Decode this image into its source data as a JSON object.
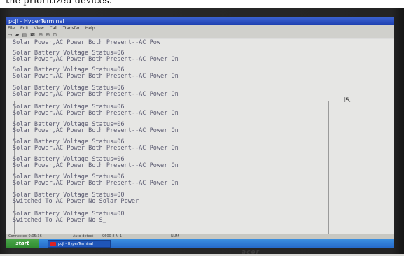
{
  "caption": "the prioritized devices.",
  "window": {
    "title": "pcjl - HyperTerminal",
    "menu": [
      "File",
      "Edit",
      "View",
      "Call",
      "Transfer",
      "Help"
    ],
    "toolbar_glyphs": "▭ ▰ ▤ ☎ ⊟ ⊞ ⊡"
  },
  "terminal": {
    "lines": [
      "Solar Power,AC Power Both Present--AC Pow",
      "Solar Battery Voltage Status=06",
      "Solar Power,AC Power Both Present--AC Power On",
      "Solar Battery Voltage Status=06",
      "Solar Power,AC Power Both Present--AC Power On",
      "Solar Battery Voltage Status=06",
      "Solar Power,AC Power Both Present--AC Power On",
      "Solar Battery Voltage Status=06",
      "Solar Power,AC Power Both Present--AC Power On",
      "Solar Battery Voltage Status=06",
      "Solar Power,AC Power Both Present--AC Power On",
      "Solar Battery Voltage Status=06",
      "Solar Power,AC Power Both Present--AC Power On",
      "Solar Battery Voltage Status=06",
      "Solar Power,AC Power Both Present--AC Power On",
      "Solar Battery Voltage Status=06",
      "Solar Power,AC Power Both Present--AC Power On",
      "Solar Battery Voltage Status=00",
      "Switched To AC Power No Solar Power",
      "Solar Battery Voltage Status=00",
      "Switched To AC Power No S_"
    ]
  },
  "statusbar": {
    "connected": "Connected 0:05:36",
    "detect": "Auto detect",
    "settings": "9600 8-N-1",
    "num": "NUM"
  },
  "taskbar": {
    "start_label": "start",
    "task_label": "pcjl - HyperTerminal"
  },
  "bezel_logo": "acer"
}
